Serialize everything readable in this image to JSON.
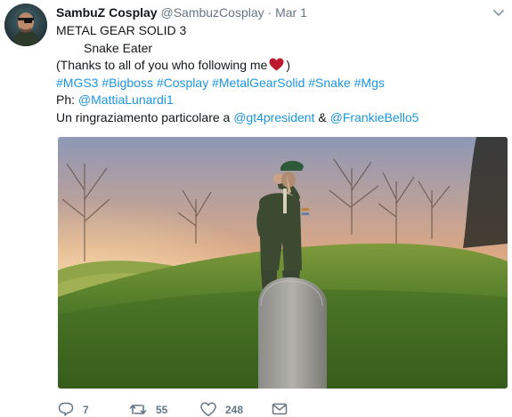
{
  "tweet": {
    "author_name": "SambuZ Cosplay",
    "author_handle": "@SambuzCosplay",
    "separator": "·",
    "date": "Mar 1",
    "lines": {
      "title": "METAL GEAR SOLID 3",
      "subtitle": "Snake Eater",
      "thanks_before": "(Thanks to all of you who following me",
      "thanks_after": ")",
      "hashtags": "#MGS3 #Bigboss #Cosplay #MetalGearSolid #Snake #Mgs",
      "photo_prefix": "Ph: ",
      "photo_mention": "@MattiaLunardi1",
      "thanks_it_prefix": "Un ringraziamento particolare a ",
      "mention_1": "@gt4president",
      "amp": " & ",
      "mention_2": "@FrankieBello5"
    },
    "media_alt": "Photo of a uniformed soldier in a green beret saluting before a gravestone on a grassy hill at sunset"
  },
  "actions": {
    "replies": "7",
    "retweets": "55",
    "likes": "248"
  },
  "colors": {
    "link": "#1b95e0",
    "secondary_text": "#657786",
    "heart": "#e0245e"
  },
  "icons": {
    "avatar": "profile-avatar",
    "caret": "chevron-down-icon",
    "reply": "reply-icon",
    "retweet": "retweet-icon",
    "like": "heart-icon",
    "dm": "direct-message-icon",
    "emoji": "red-heart-emoji"
  }
}
